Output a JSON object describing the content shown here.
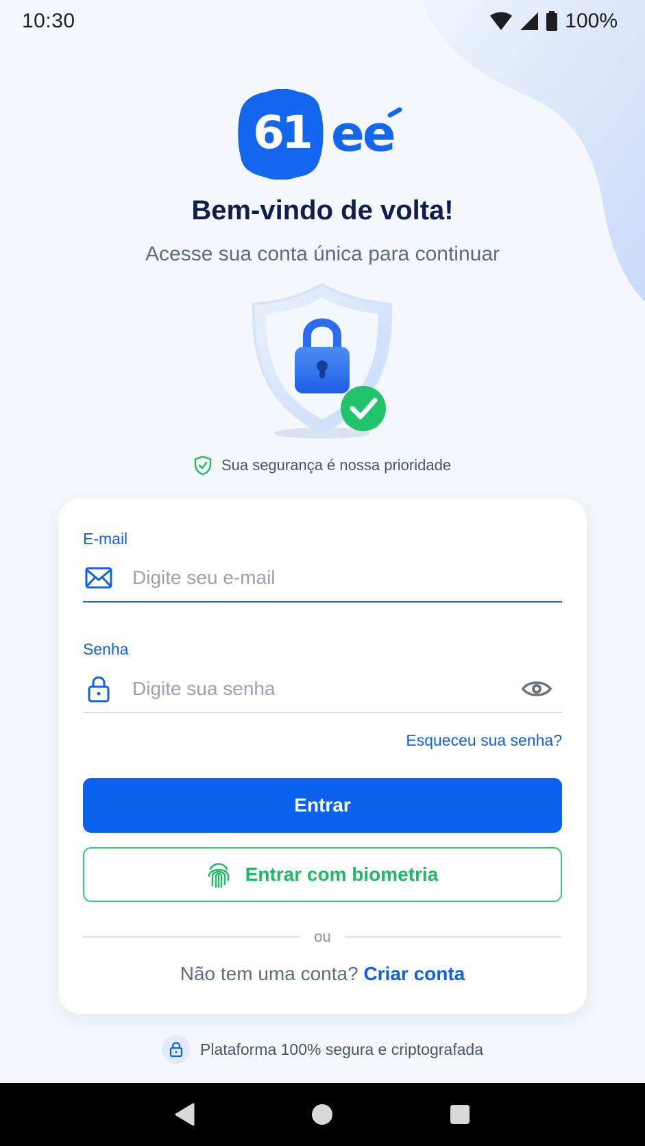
{
  "status_bar": {
    "time": "10:30",
    "battery": "100%",
    "icons": [
      "wifi-icon",
      "signal-icon",
      "battery-icon"
    ]
  },
  "brand": {
    "logo_text": "61ee",
    "accent": "#0b62f0",
    "success": "#22c36b"
  },
  "header": {
    "title": "Bem-vindo de volta!",
    "subtitle": "Acesse sua conta única para continuar"
  },
  "security_note": {
    "icon": "shield-check-icon",
    "text": "Sua segurança é nossa prioridade"
  },
  "form": {
    "email": {
      "label": "E-mail",
      "placeholder": "Digite seu e-mail",
      "value": "",
      "icon": "mail-icon"
    },
    "password": {
      "label": "Senha",
      "placeholder": "Digite sua senha",
      "value": "",
      "icon": "lock-icon",
      "toggle_icon": "eye-icon"
    },
    "forgot_password": "Esqueceu sua senha?",
    "submit_label": "Entrar",
    "biometric_label": "Entrar com biometria",
    "biometric_icon": "fingerprint-icon",
    "divider_text": "ou",
    "signup_prompt": "Não tem uma conta?",
    "signup_link": "Criar conta"
  },
  "footer": {
    "icon": "lock-icon",
    "text": "Plataforma 100% segura e criptografada"
  },
  "nav_bar": {
    "buttons": [
      "back-icon",
      "home-icon",
      "recents-icon"
    ]
  }
}
